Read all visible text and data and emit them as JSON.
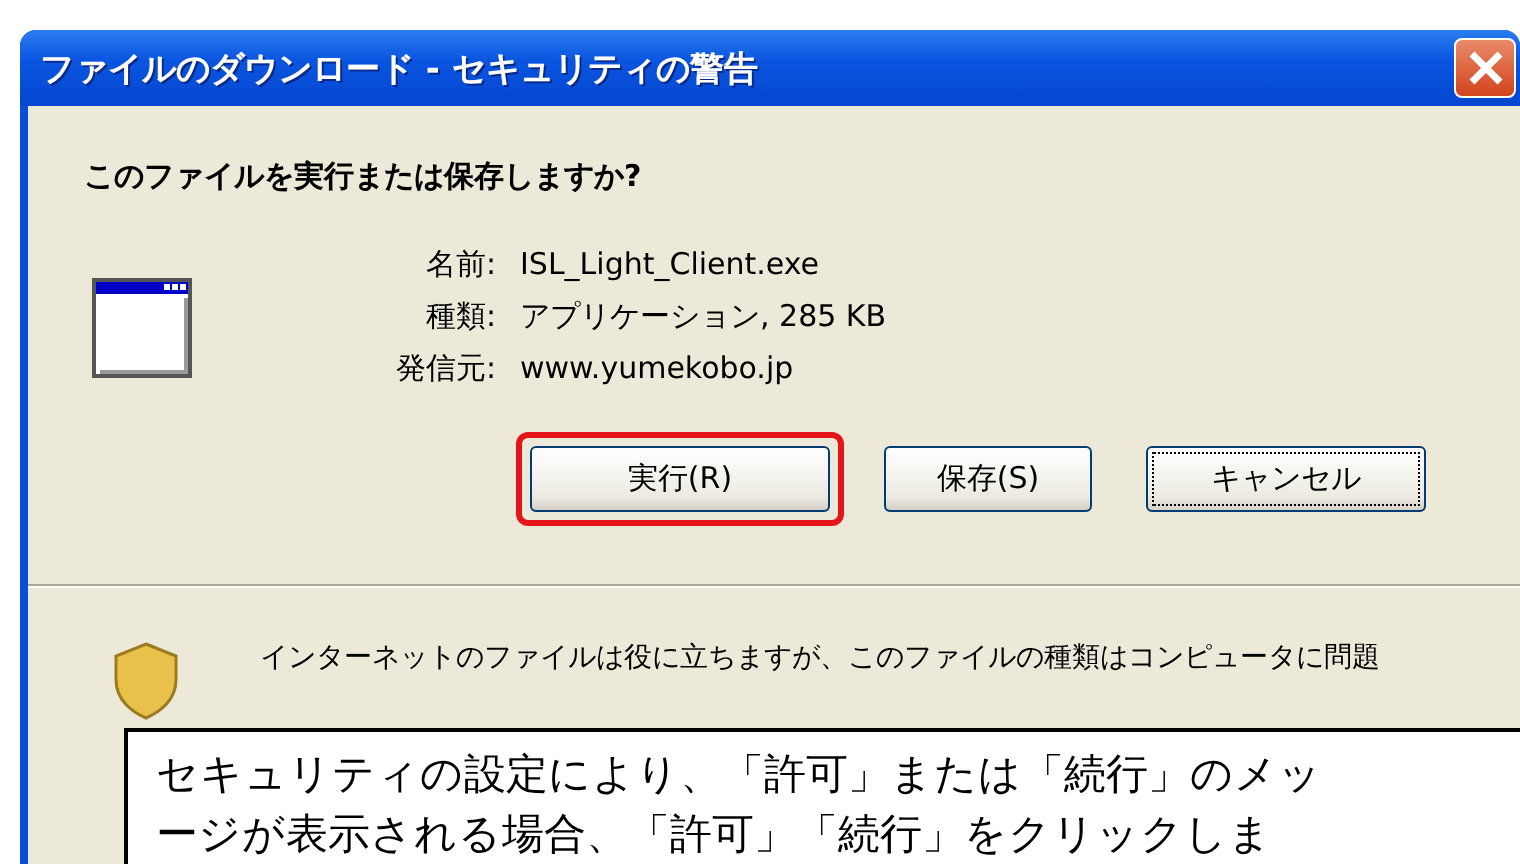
{
  "window": {
    "title": "ファイルのダウンロード - セキュリティの警告"
  },
  "question": "このファイルを実行または保存しますか?",
  "details": [
    {
      "label": "名前:",
      "value": "ISL_Light_Client.exe"
    },
    {
      "label": "種類:",
      "value": "アプリケーション, 285 KB"
    },
    {
      "label": "発信元:",
      "value": "www.yumekobo.jp"
    }
  ],
  "buttons": [
    {
      "label": "実行(R)",
      "focused": false,
      "highlighted": true
    },
    {
      "label": "保存(S)",
      "focused": false,
      "highlighted": false
    },
    {
      "label": "キャンセル",
      "focused": true,
      "highlighted": false
    }
  ],
  "warning": "インターネットのファイルは役に立ちますが、このファイルの種類はコンピュータに問題",
  "callout": {
    "lines": [
      "セキュリティの設定により、「許可」または「続行」のメッ",
      "ージが表示される場合、「許可」「続行」をクリックしま"
    ]
  }
}
